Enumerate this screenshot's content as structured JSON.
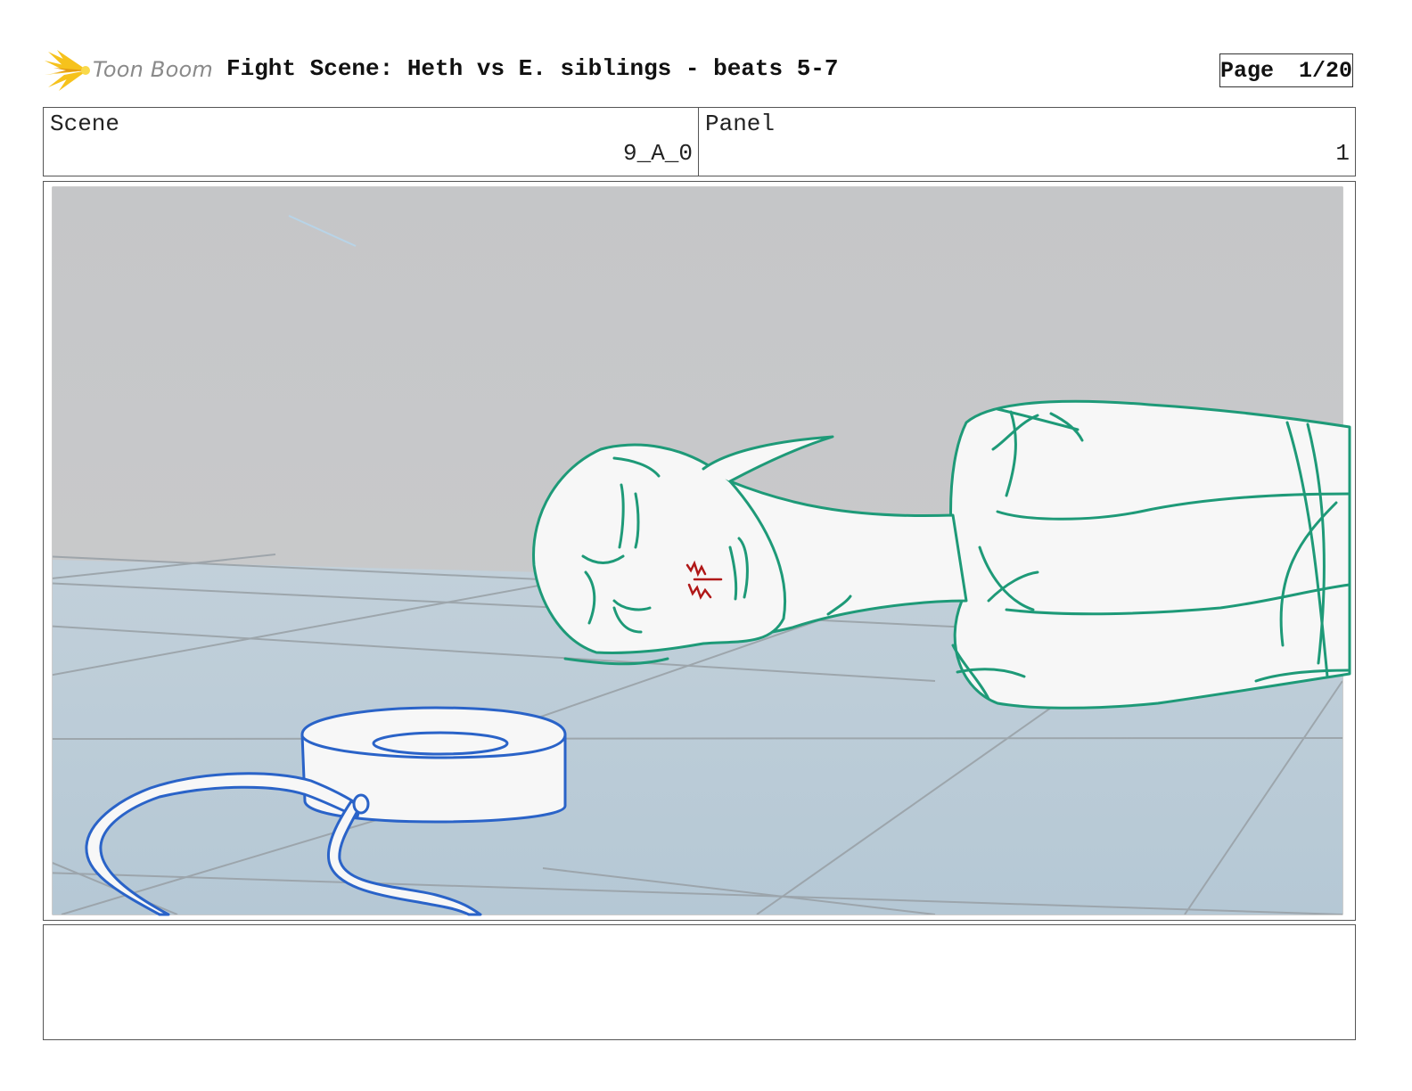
{
  "header": {
    "logo_text": "Toon Boom",
    "title": "Fight Scene: Heth vs E. siblings - beats 5-7",
    "page_label": "Page",
    "page_value": "1/20"
  },
  "info": {
    "scene_label": "Scene",
    "scene_value": "9_A_0",
    "panel_label": "Panel",
    "panel_value": "1"
  },
  "icons": {
    "logo": "toon-boom-starburst-icon"
  },
  "colors": {
    "sketch_character": "#1e9a78",
    "sketch_prop": "#2a63c8",
    "sketch_blood": "#b01818",
    "wall": "#c8c9cb",
    "floor": "#b8cad6",
    "logo_yellow": "#f6c21c"
  },
  "notes": {
    "text": ""
  }
}
